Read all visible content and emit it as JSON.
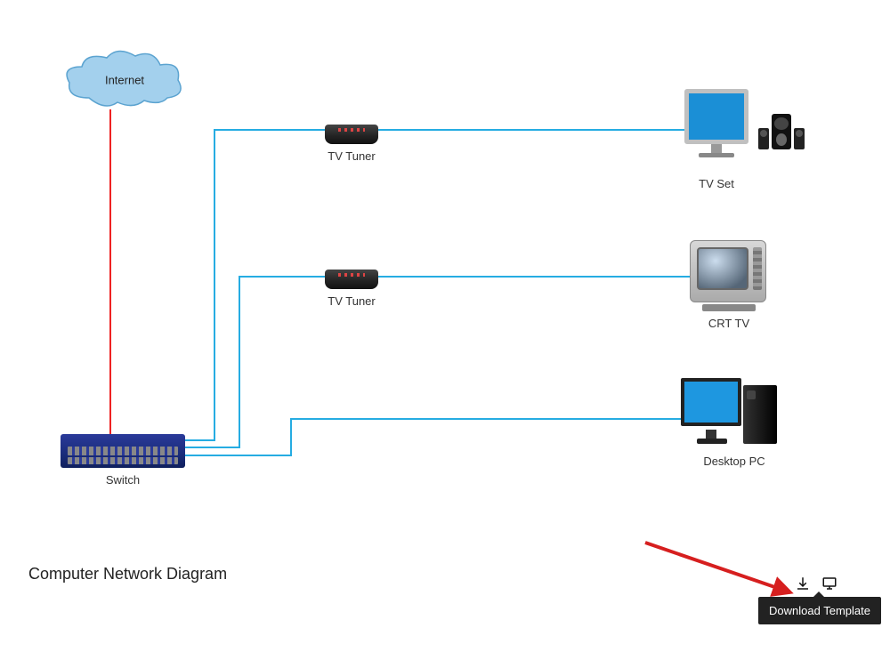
{
  "title": "Computer Network Diagram",
  "nodes": {
    "internet": {
      "label": "Internet"
    },
    "switch": {
      "label": "Switch"
    },
    "tuner1": {
      "label": "TV Tuner"
    },
    "tuner2": {
      "label": "TV Tuner"
    },
    "tvset": {
      "label": "TV Set"
    },
    "crt": {
      "label": "CRT TV"
    },
    "desktop": {
      "label": "Desktop PC"
    }
  },
  "actions": {
    "download_tooltip": "Download Template"
  },
  "colors": {
    "connection": "#26ace2",
    "internet_line": "#e22",
    "arrow": "#d61f1f"
  }
}
